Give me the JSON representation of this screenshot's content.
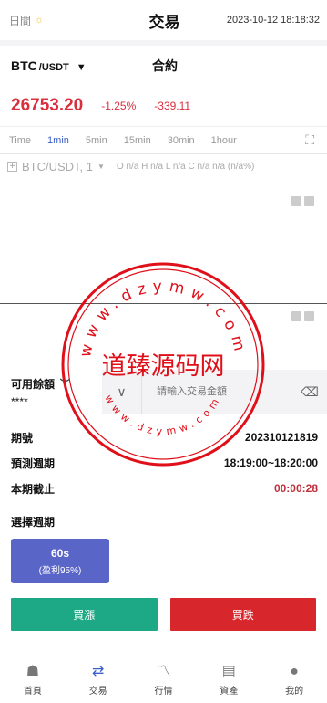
{
  "header": {
    "left_label": "日間",
    "title": "交易",
    "datetime": "2023-10-12 18:18:32"
  },
  "pair": {
    "base": "BTC",
    "quote": "/USDT",
    "contract_label": "合約"
  },
  "price": {
    "last": "26753.20",
    "change_pct": "-1.25%",
    "change": "-339.11"
  },
  "intervals": [
    "Time",
    "1min",
    "5min",
    "15min",
    "30min",
    "1hour"
  ],
  "active_interval": "1min",
  "chart": {
    "symbol": "BTC/USDT, 1",
    "ohlc": "O n/a  H n/a  L n/a  C n/a   n/a (n/a%)"
  },
  "trade": {
    "balance_label": "可用餘額",
    "balance_value": "****",
    "amount_placeholder": "請輸入交易金額"
  },
  "period": {
    "rows": [
      {
        "label": "期號",
        "value": "202310121819"
      },
      {
        "label": "預測週期",
        "value": "18:19:00~18:20:00"
      },
      {
        "label": "本期截止",
        "value": "00:00:28"
      }
    ]
  },
  "select": {
    "label": "選擇週期",
    "options": [
      {
        "duration": "60s",
        "profit": "(盈利95%)"
      }
    ]
  },
  "actions": {
    "up_label": "買漲",
    "down_label": "買跌"
  },
  "watermark": {
    "center_text": "道臻源码网",
    "arc_text": "www.dzymw.com"
  },
  "tabs": [
    {
      "label": "首頁",
      "icon": "home-icon"
    },
    {
      "label": "交易",
      "icon": "trade-icon"
    },
    {
      "label": "行情",
      "icon": "market-icon"
    },
    {
      "label": "資產",
      "icon": "assets-icon"
    },
    {
      "label": "我的",
      "icon": "profile-icon"
    }
  ],
  "colors": {
    "accent": "#3b5fc8",
    "down_red": "#d9303e",
    "buy_up": "#1ea986",
    "buy_down": "#d8262d",
    "card": "#5a65c8",
    "watermark": "#e0101a"
  }
}
